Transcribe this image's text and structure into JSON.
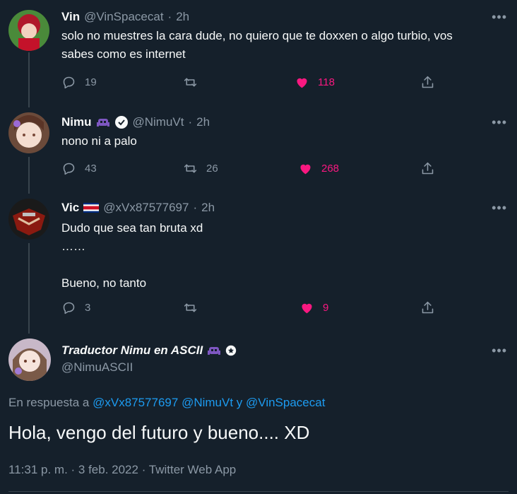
{
  "tweets": [
    {
      "name": "Vin",
      "handle": "@VinSpacecat",
      "time": "2h",
      "text_lines": [
        "solo no muestres la cara dude, no quiero que te doxxen o algo turbio, vos",
        "sabes como es internet"
      ],
      "replies": "19",
      "retweets": "",
      "likes": "118"
    },
    {
      "name": "Nimu",
      "handle": "@NimuVt",
      "time": "2h",
      "text_lines": [
        "nono ni a palo"
      ],
      "replies": "43",
      "retweets": "26",
      "likes": "268"
    },
    {
      "name": "Vic",
      "handle": "@xVx87577697",
      "time": "2h",
      "text_lines": [
        "Dudo que sea tan bruta xd",
        "……",
        "",
        "Bueno, no tanto"
      ],
      "replies": "3",
      "retweets": "",
      "likes": "9"
    }
  ],
  "main": {
    "name": "Traductor Nimu en ASCII",
    "handle": "@NimuASCII",
    "reply_prefix": "En respuesta a",
    "reply_handles": [
      "@xVx87577697",
      "@NimuVt",
      "@VinSpacecat"
    ],
    "reply_and": "y",
    "text": "Hola, vengo del futuro y bueno.... XD",
    "meta": "11:31 p. m. · 3 feb. 2022 · Twitter Web App"
  },
  "common": {
    "dot": "·",
    "more": "•••"
  },
  "colors": {
    "background": "#15202b",
    "like": "#f91880",
    "link": "#1d9bf0",
    "muted": "#8b98a5"
  }
}
